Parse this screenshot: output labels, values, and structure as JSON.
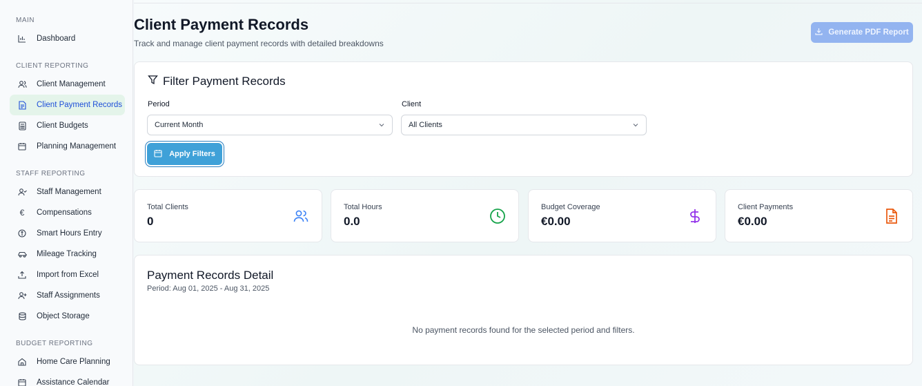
{
  "sidebar": {
    "sections": [
      {
        "label": "MAIN"
      },
      {
        "label": "CLIENT REPORTING"
      },
      {
        "label": "STAFF REPORTING"
      },
      {
        "label": "BUDGET REPORTING"
      }
    ],
    "items": [
      {
        "label": "Dashboard",
        "icon": "bar-chart-icon"
      },
      {
        "label": "Client Management",
        "icon": "users-icon"
      },
      {
        "label": "Client Payment Records",
        "icon": "document-icon"
      },
      {
        "label": "Client Budgets",
        "icon": "calculator-icon"
      },
      {
        "label": "Planning Management",
        "icon": "calendar-icon"
      },
      {
        "label": "Staff Management",
        "icon": "user-check-icon"
      },
      {
        "label": "Compensations",
        "icon": "euro-icon"
      },
      {
        "label": "Smart Hours Entry",
        "icon": "timer-icon"
      },
      {
        "label": "Mileage Tracking",
        "icon": "car-icon"
      },
      {
        "label": "Import from Excel",
        "icon": "upload-icon"
      },
      {
        "label": "Staff Assignments",
        "icon": "user-plus-icon"
      },
      {
        "label": "Object Storage",
        "icon": "database-icon"
      },
      {
        "label": "Home Care Planning",
        "icon": "home-icon"
      },
      {
        "label": "Assistance Calendar",
        "icon": "calendar-icon"
      }
    ],
    "active_item": "Client Payment Records"
  },
  "header": {
    "title": "Client Payment Records",
    "subtitle": "Track and manage client payment records with detailed breakdowns",
    "pdf_button": "Generate PDF Report"
  },
  "filters": {
    "title": "Filter Payment Records",
    "period_label": "Period",
    "period_value": "Current Month",
    "client_label": "Client",
    "client_value": "All Clients",
    "apply_button": "Apply Filters"
  },
  "stats": [
    {
      "label": "Total Clients",
      "value": "0",
      "icon": "users-icon",
      "color": "#3b82f6"
    },
    {
      "label": "Total Hours",
      "value": "0.0",
      "icon": "clock-icon",
      "color": "#16a34a"
    },
    {
      "label": "Budget Coverage",
      "value": "€0.00",
      "icon": "dollar-icon",
      "color": "#9333ea"
    },
    {
      "label": "Client Payments",
      "value": "€0.00",
      "icon": "file-icon",
      "color": "#ea580c"
    }
  ],
  "detail": {
    "title": "Payment Records Detail",
    "period": "Period: Aug 01, 2025 - Aug 31, 2025",
    "empty_message": "No payment records found for the selected period and filters."
  },
  "colors": {
    "accent": "#3fa1d8",
    "active_bg": "#e4f4ea",
    "active_text": "#1d4ed8"
  }
}
